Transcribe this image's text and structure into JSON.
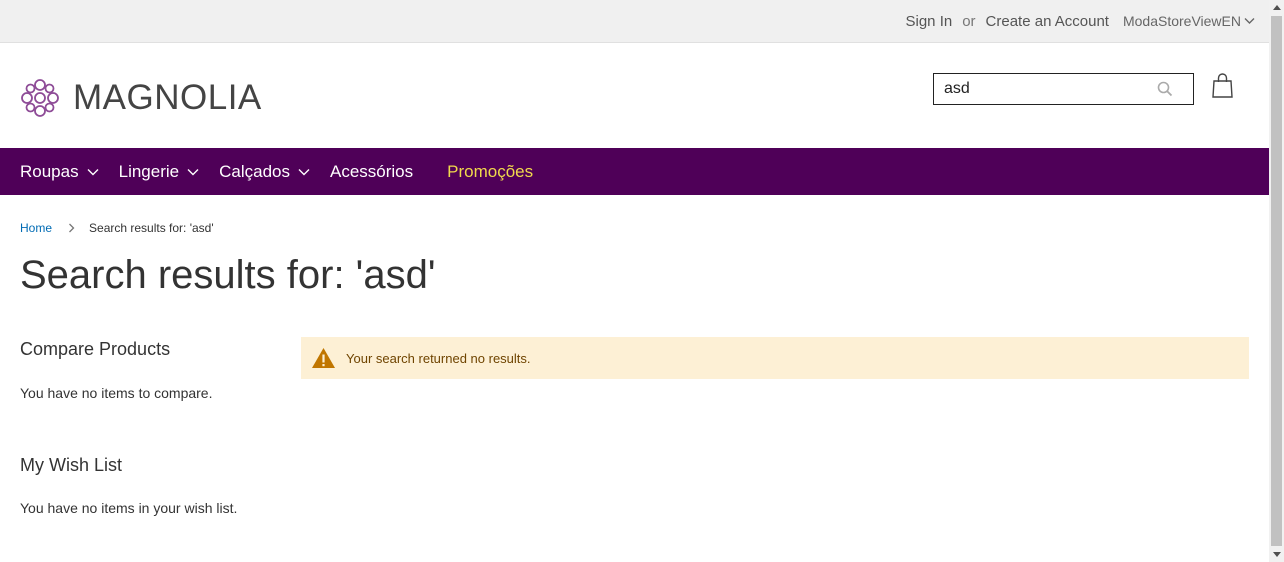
{
  "topbar": {
    "sign_in": "Sign In",
    "or": "or",
    "create_account": "Create an Account",
    "store_view": "ModaStoreViewEN"
  },
  "header": {
    "logo_text": "MAGNOLIA",
    "search_value": "asd",
    "icons": {
      "search": "search-icon",
      "cart": "cart-icon",
      "logo": "magnolia-logo-icon"
    }
  },
  "nav": {
    "items": [
      {
        "label": "Roupas",
        "has_dropdown": true
      },
      {
        "label": "Lingerie",
        "has_dropdown": true
      },
      {
        "label": "Calçados",
        "has_dropdown": true
      },
      {
        "label": "Acessórios",
        "has_dropdown": false
      },
      {
        "label": "Promoções",
        "has_dropdown": false
      }
    ]
  },
  "breadcrumb": {
    "home": "Home",
    "current": "Search results for: 'asd'"
  },
  "page": {
    "title": "Search results for: 'asd'"
  },
  "sidebar": {
    "compare_title": "Compare Products",
    "compare_text": "You have no items to compare.",
    "wishlist_title": "My Wish List",
    "wishlist_text": "You have no items in your wish list."
  },
  "message": {
    "text": "Your search returned no results.",
    "icon": "warning-icon"
  },
  "colors": {
    "nav_bg": "#4f0058",
    "promo": "#f0d94c",
    "link": "#006bb4",
    "warning_bg": "#fdf0d5",
    "warning_icon": "#c07600",
    "logo": "#8e4c97"
  }
}
